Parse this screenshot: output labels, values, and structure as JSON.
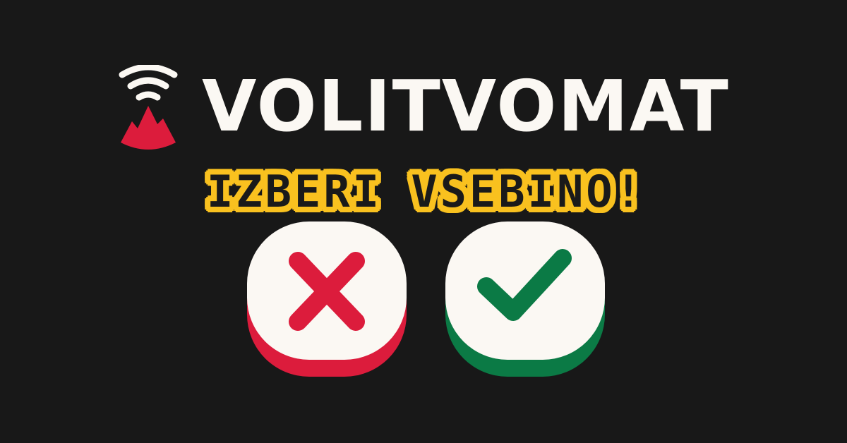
{
  "brand": {
    "logo_icon": "mountain-signal-icon",
    "title": "VOLITVOMAT"
  },
  "tagline": {
    "text": "IZBERI VSEBINO!"
  },
  "buttons": {
    "no": {
      "icon": "cross-icon",
      "accent": "#dc1c3c"
    },
    "yes": {
      "icon": "check-icon",
      "accent": "#0b7a45"
    }
  },
  "colors": {
    "background": "#181818",
    "title": "#fbf8f3",
    "tagline_fill": "#1a1a1a",
    "tagline_outline": "#f9c11f",
    "logo_red": "#dc1c3c",
    "logo_signal": "#fbf8f3"
  }
}
